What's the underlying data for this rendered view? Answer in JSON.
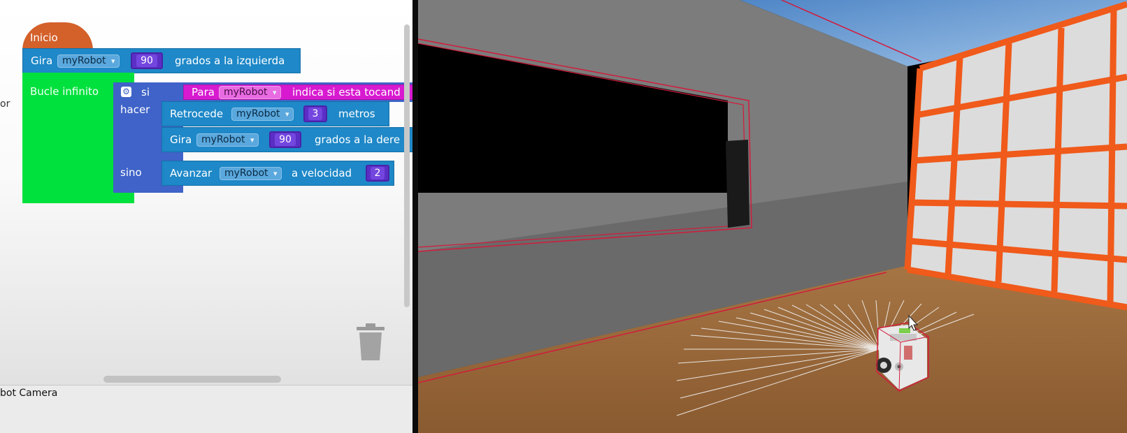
{
  "workspace": {
    "left_cut_text": "or",
    "blocks": {
      "start_hat": "Inicio",
      "turn_left": {
        "verb": "Gira",
        "robot": "myRobot",
        "value": "90",
        "suffix": "grados a la izquierda"
      },
      "loop": "Bucle infinito",
      "if": {
        "si": "si",
        "hacer": "hacer",
        "sino": "sino"
      },
      "touch": {
        "verb": "Para",
        "robot": "myRobot",
        "suffix": "indica si esta tocand"
      },
      "backward": {
        "verb": "Retrocede",
        "robot": "myRobot",
        "value": "3",
        "suffix": "metros"
      },
      "turn_right": {
        "verb": "Gira",
        "robot": "myRobot",
        "value": "90",
        "suffix": "grados a la dere"
      },
      "advance": {
        "verb": "Avanzar",
        "robot": "myRobot",
        "middle": "a velocidad",
        "value": "2"
      }
    },
    "status_label": "bot Camera"
  },
  "colors": {
    "hat": "#d4602a",
    "motion": "#1e88c8",
    "loop": "#00e13d",
    "logic": "#3f63c8",
    "sensor": "#d71ad0",
    "number": "#5b2fc6"
  },
  "icons": [
    "gear-icon",
    "dropdown-arrow-icon",
    "trash-icon",
    "mouse-cursor-icon"
  ]
}
